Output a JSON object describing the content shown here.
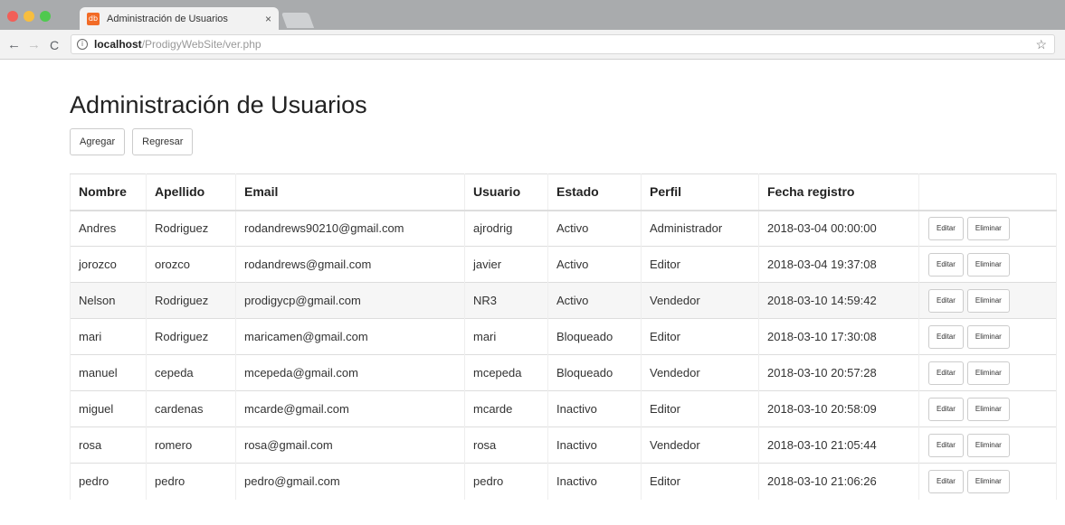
{
  "browser": {
    "tab_title": "Administración de Usuarios",
    "tab_favicon": "db",
    "url_host": "localhost",
    "url_path": "/ProdigyWebSite/ver.php"
  },
  "page": {
    "title": "Administración de Usuarios",
    "add_label": "Agregar",
    "back_label": "Regresar"
  },
  "table": {
    "headers": [
      "Nombre",
      "Apellido",
      "Email",
      "Usuario",
      "Estado",
      "Perfil",
      "Fecha registro",
      ""
    ],
    "edit_label": "Editar",
    "delete_label": "Eliminar",
    "rows": [
      [
        "Andres",
        "Rodriguez",
        "rodandrews90210@gmail.com",
        "ajrodrig",
        "Activo",
        "Administrador",
        "2018-03-04 00:00:00"
      ],
      [
        "jorozco",
        "orozco",
        "rodandrews@gmail.com",
        "javier",
        "Activo",
        "Editor",
        "2018-03-04 19:37:08"
      ],
      [
        "Nelson",
        "Rodriguez",
        "prodigycp@gmail.com",
        "NR3",
        "Activo",
        "Vendedor",
        "2018-03-10 14:59:42"
      ],
      [
        "mari",
        "Rodriguez",
        "maricamen@gmail.com",
        "mari",
        "Bloqueado",
        "Editor",
        "2018-03-10 17:30:08"
      ],
      [
        "manuel",
        "cepeda",
        "mcepeda@gmail.com",
        "mcepeda",
        "Bloqueado",
        "Vendedor",
        "2018-03-10 20:57:28"
      ],
      [
        "miguel",
        "cardenas",
        "mcarde@gmail.com",
        "mcarde",
        "Inactivo",
        "Editor",
        "2018-03-10 20:58:09"
      ],
      [
        "rosa",
        "romero",
        "rosa@gmail.com",
        "rosa",
        "Inactivo",
        "Vendedor",
        "2018-03-10 21:05:44"
      ],
      [
        "pedro",
        "pedro",
        "pedro@gmail.com",
        "pedro",
        "Inactivo",
        "Editor",
        "2018-03-10 21:06:26"
      ]
    ]
  }
}
